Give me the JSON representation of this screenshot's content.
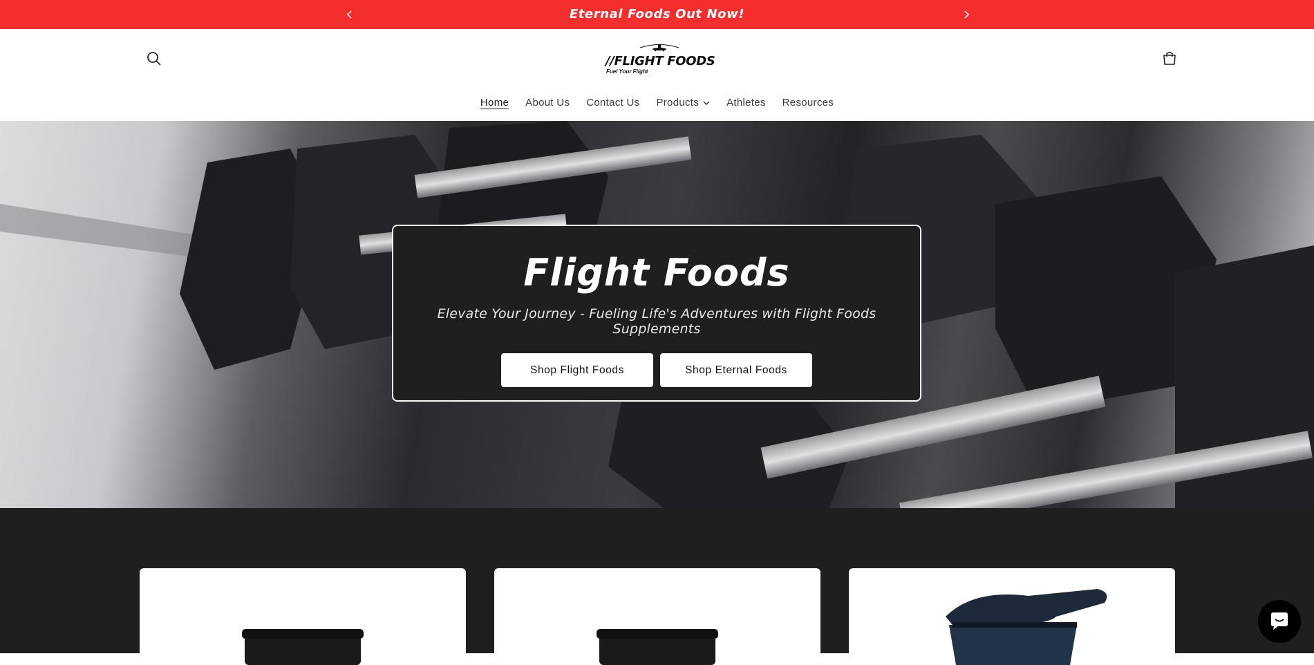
{
  "announcement": {
    "text": "Eternal Foods Out Now!",
    "prev_icon": "chevron-left-icon",
    "next_icon": "chevron-right-icon",
    "background": "#f42d2d"
  },
  "header": {
    "search_icon": "search-icon",
    "cart_icon": "cart-icon",
    "logo": {
      "text": "//FLIGHT FOODS",
      "tagline": "Fuel Your Flight",
      "icon": "airplane-icon"
    },
    "nav": [
      {
        "label": "Home",
        "active": true
      },
      {
        "label": "About Us"
      },
      {
        "label": "Contact Us"
      },
      {
        "label": "Products",
        "has_dropdown": true
      },
      {
        "label": "Athletes"
      },
      {
        "label": "Resources"
      }
    ]
  },
  "hero": {
    "title": "Flight Foods",
    "subtitle": "Elevate Your Journey - Fueling Life's Adventures with Flight Foods Supplements",
    "buttons": [
      {
        "label": "Shop Flight Foods"
      },
      {
        "label": "Shop Eternal Foods"
      }
    ],
    "background_image": "dumbbell rack photo"
  },
  "products": {
    "background": "#1f1f1f",
    "cards": [
      {
        "image": "supplement-tub"
      },
      {
        "image": "supplement-tub"
      },
      {
        "image": "shaker-bottle"
      }
    ]
  },
  "chat": {
    "icon": "chat-icon"
  }
}
